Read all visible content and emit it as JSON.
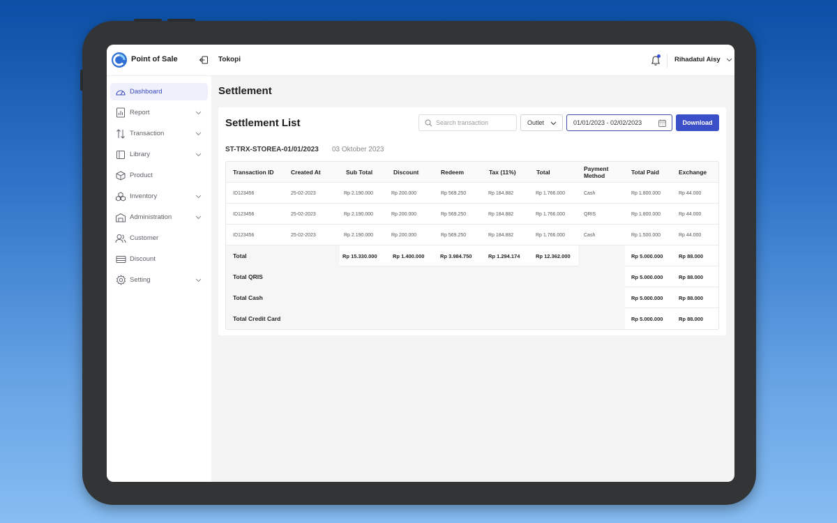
{
  "header": {
    "app_name": "Point of Sale",
    "store_name": "Tokopi",
    "user_name": "Rihadatul Aisy"
  },
  "sidebar": {
    "items": [
      {
        "label": "Dashboard",
        "icon": "dashboard-icon",
        "active": true,
        "expandable": false
      },
      {
        "label": "Report",
        "icon": "report-icon",
        "active": false,
        "expandable": true
      },
      {
        "label": "Transaction",
        "icon": "transaction-icon",
        "active": false,
        "expandable": true
      },
      {
        "label": "Library",
        "icon": "library-icon",
        "active": false,
        "expandable": true
      },
      {
        "label": "Product",
        "icon": "product-icon",
        "active": false,
        "expandable": false
      },
      {
        "label": "Inventory",
        "icon": "inventory-icon",
        "active": false,
        "expandable": true
      },
      {
        "label": "Administration",
        "icon": "administration-icon",
        "active": false,
        "expandable": true
      },
      {
        "label": "Customer",
        "icon": "customer-icon",
        "active": false,
        "expandable": false
      },
      {
        "label": "Discount",
        "icon": "discount-icon",
        "active": false,
        "expandable": false
      },
      {
        "label": "Setting",
        "icon": "setting-icon",
        "active": false,
        "expandable": true
      }
    ]
  },
  "main": {
    "page_title": "Settlement",
    "card_title": "Settlement List",
    "search_placeholder": "Search transaction",
    "outlet_label": "Outlet",
    "date_range": "01/01/2023 - 02/02/2023",
    "download_label": "Download",
    "batch_id": "ST-TRX-STOREA-01/01/2023",
    "batch_date": "03 Oktober 2023"
  },
  "table": {
    "columns": [
      "Transaction ID",
      "Created At",
      "Sub Total",
      "Discount",
      "Redeem",
      "Tax (11%)",
      "Total",
      "Payment Method",
      "Total Paid",
      "Exchange"
    ],
    "rows": [
      [
        "ID123456",
        "25-02-2023",
        "Rp 2.190.000",
        "Rp 200.000",
        "Rp 569.250",
        "Rp 184.882",
        "Rp 1.766.000",
        "Cash",
        "Rp 1.800.000",
        "Rp 44.000"
      ],
      [
        "ID123456",
        "25-02-2023",
        "Rp 2.190.000",
        "Rp 200.000",
        "Rp 569.250",
        "Rp 184.882",
        "Rp 1.766.000",
        "QRIS",
        "Rp 1.800.000",
        "Rp 44.000"
      ],
      [
        "ID123456",
        "25-02-2023",
        "Rp 2.190.000",
        "Rp 200.000",
        "Rp 569.250",
        "Rp 184.882",
        "Rp 1.766.000",
        "Cash",
        "Rp 1.500.000",
        "Rp 44.000"
      ]
    ],
    "total": {
      "label": "Total",
      "sub_total": "Rp 15.330.000",
      "discount": "Rp 1.400.000",
      "redeem": "Rp 3.984.750",
      "tax": "Rp 1.294.174",
      "total": "Rp 12.362.000",
      "total_paid": "Rp 5.000.000",
      "exchange": "Rp 88.000"
    },
    "summaries": [
      {
        "label": "Total QRIS",
        "total_paid": "Rp 5.000.000",
        "exchange": "Rp 88.000"
      },
      {
        "label": "Total Cash",
        "total_paid": "Rp 5.000.000",
        "exchange": "Rp 88.000"
      },
      {
        "label": "Total Credit Card",
        "total_paid": "Rp 5.000.000",
        "exchange": "Rp 88.000"
      }
    ]
  },
  "colors": {
    "accent": "#3b4fc8",
    "active_nav_bg": "#eef0fb",
    "active_nav_text": "#3949c4",
    "notification_dot": "#3b4fd8"
  }
}
